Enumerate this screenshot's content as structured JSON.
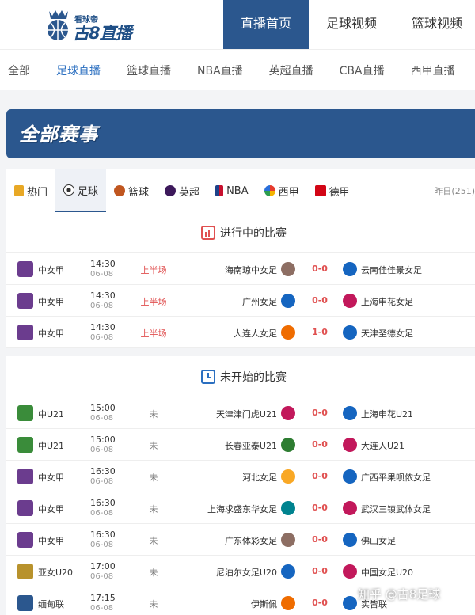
{
  "header": {
    "logo_small": "看球帝",
    "logo_big": "古8直播",
    "nav": [
      "直播首页",
      "足球视频",
      "篮球视频"
    ]
  },
  "subnav": [
    "全部",
    "足球直播",
    "篮球直播",
    "NBA直播",
    "英超直播",
    "CBA直播",
    "西甲直播"
  ],
  "banner": {
    "title": "全部赛事"
  },
  "tabs": {
    "items": [
      "热门",
      "足球",
      "篮球",
      "英超",
      "NBA",
      "西甲",
      "德甲"
    ],
    "yesterday": "昨日(251)"
  },
  "live_section": {
    "title": "进行中的比赛",
    "rows": [
      {
        "league": "中女甲",
        "time": "14:30",
        "date": "06-08",
        "status": "上半场",
        "home": "海南琼中女足",
        "score": "0-0",
        "away": "云南佳佳景女足"
      },
      {
        "league": "中女甲",
        "time": "14:30",
        "date": "06-08",
        "status": "上半场",
        "home": "广州女足",
        "score": "0-0",
        "away": "上海申花女足"
      },
      {
        "league": "中女甲",
        "time": "14:30",
        "date": "06-08",
        "status": "上半场",
        "home": "大连人女足",
        "score": "1-0",
        "away": "天津圣德女足"
      }
    ]
  },
  "upcoming_section": {
    "title": "未开始的比赛",
    "rows": [
      {
        "league": "中U21",
        "time": "15:00",
        "date": "06-08",
        "status": "未",
        "home": "天津津门虎U21",
        "score": "0-0",
        "away": "上海申花U21"
      },
      {
        "league": "中U21",
        "time": "15:00",
        "date": "06-08",
        "status": "未",
        "home": "长春亚泰U21",
        "score": "0-0",
        "away": "大连人U21"
      },
      {
        "league": "中女甲",
        "time": "16:30",
        "date": "06-08",
        "status": "未",
        "home": "河北女足",
        "score": "0-0",
        "away": "广西平果呗侬女足"
      },
      {
        "league": "中女甲",
        "time": "16:30",
        "date": "06-08",
        "status": "未",
        "home": "上海求盛东华女足",
        "score": "0-0",
        "away": "武汉三镇武体女足"
      },
      {
        "league": "中女甲",
        "time": "16:30",
        "date": "06-08",
        "status": "未",
        "home": "广东体彩女足",
        "score": "0-0",
        "away": "佛山女足"
      },
      {
        "league": "亚女U20",
        "time": "17:00",
        "date": "06-08",
        "status": "未",
        "home": "尼泊尔女足U20",
        "score": "0-0",
        "away": "中国女足U20"
      },
      {
        "league": "缅甸联",
        "time": "17:15",
        "date": "06-08",
        "status": "未",
        "home": "伊斯佩",
        "score": "0-0",
        "away": "实皆联"
      }
    ]
  },
  "watermark": "知乎 @古8足球",
  "colors": {
    "primary": "#2b578e",
    "live": "#e05050",
    "link": "#2b6fc0"
  }
}
